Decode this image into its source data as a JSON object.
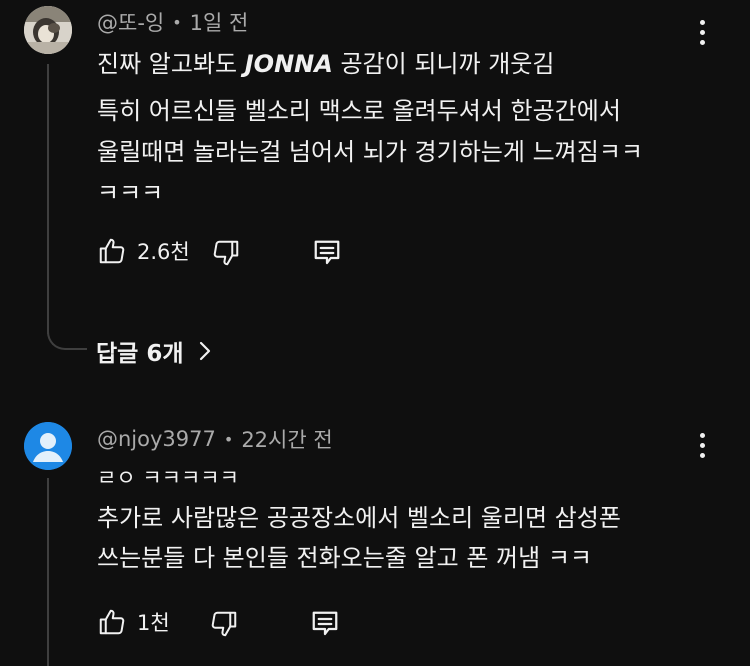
{
  "comment1": {
    "author": "@또-잉",
    "sep": "•",
    "time": "1일 전",
    "line1_pre": "진짜 알고봐도 ",
    "line1_bold": "JONNA",
    "line1_post": " 공감이 되니까 개웃김",
    "line2": "특히 어르신들 벨소리 맥스로 올려두셔서 한공간에서",
    "line3": "울릴때면 놀라는걸 넘어서 뇌가 경기하는게 느껴짐ㅋㅋ",
    "line4": "ㅋㅋㅋ",
    "likes": "2.6천",
    "replies_label": "답글 6개",
    "avatar_icon": "profile-photo",
    "more_icon": "more-vert-icon"
  },
  "comment2": {
    "author": "@njoy3977",
    "sep": "•",
    "time": "22시간 전",
    "line1": "ㄹㅇ ㅋㅋㅋㅋㅋ",
    "line2": "추가로 사람많은 공공장소에서 벨소리 울리면 삼성폰",
    "line3": "쓰는분들 다 본인들 전화오는줄 알고 폰 꺼냄 ㅋㅋ",
    "likes": "1천",
    "avatar_color": "#1e88e5",
    "avatar_icon": "default-avatar-icon"
  },
  "icons": {
    "like": "thumbs-up-icon",
    "dislike": "thumbs-down-icon",
    "reply": "reply-comment-icon",
    "chevron": "chevron-right-icon"
  }
}
